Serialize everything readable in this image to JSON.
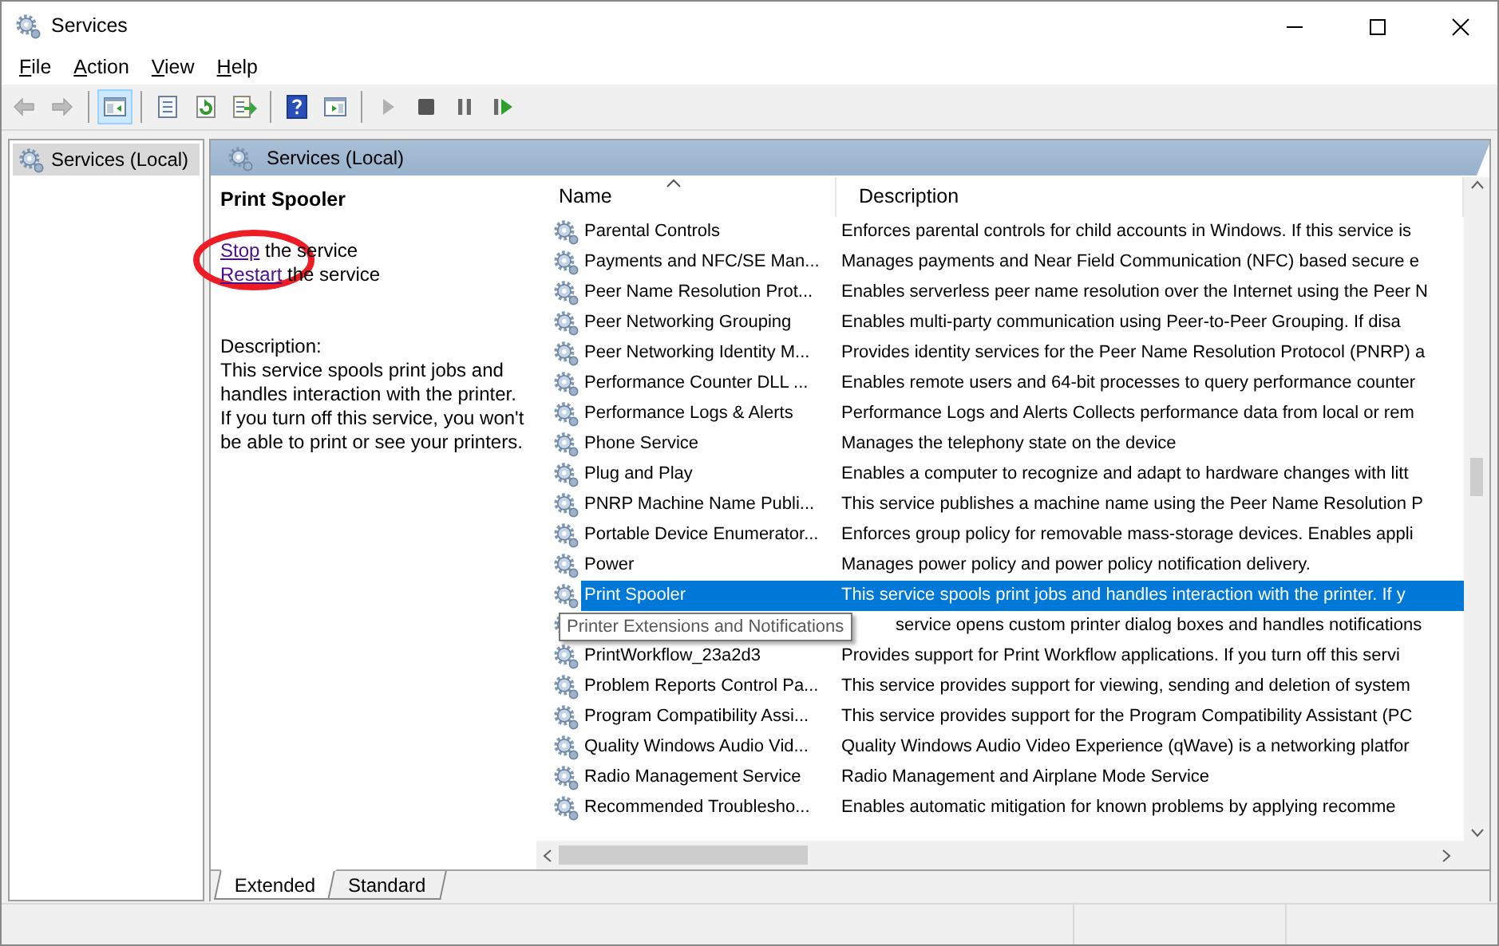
{
  "window": {
    "title": "Services"
  },
  "menu": [
    {
      "label": "File"
    },
    {
      "label": "Action"
    },
    {
      "label": "View"
    },
    {
      "label": "Help"
    }
  ],
  "toolbar": [
    {
      "kind": "back",
      "disabled": true,
      "selected": false
    },
    {
      "kind": "forward",
      "disabled": true,
      "selected": false
    },
    {
      "kind": "separator"
    },
    {
      "kind": "tree",
      "disabled": false,
      "selected": true
    },
    {
      "kind": "separator"
    },
    {
      "kind": "properties",
      "disabled": false,
      "selected": false
    },
    {
      "kind": "refresh",
      "disabled": false,
      "selected": false
    },
    {
      "kind": "export",
      "disabled": false,
      "selected": false
    },
    {
      "kind": "separator"
    },
    {
      "kind": "help",
      "disabled": false,
      "selected": false
    },
    {
      "kind": "view",
      "disabled": false,
      "selected": false
    },
    {
      "kind": "separator"
    },
    {
      "kind": "play",
      "disabled": true,
      "selected": false
    },
    {
      "kind": "stop",
      "disabled": false,
      "selected": false
    },
    {
      "kind": "pause",
      "disabled": false,
      "selected": false
    },
    {
      "kind": "resume",
      "disabled": false,
      "selected": false
    }
  ],
  "tree": [
    {
      "label": "Services (Local)",
      "selected": true
    }
  ],
  "panel_title": "Services (Local)",
  "details": {
    "title": "Print Spooler",
    "actions": [
      {
        "link": "Stop",
        "rest": "the service"
      },
      {
        "link": "Restart",
        "rest": "the service"
      }
    ],
    "description_label": "Description:",
    "description": "This service spools print jobs and handles interaction with the printer. If you turn off this service, you won't be able to print or see your printers."
  },
  "highlight_mark": {
    "kind": "ellipse"
  },
  "table": {
    "columns": [
      {
        "label": "Name",
        "sorted": true
      },
      {
        "label": "Description",
        "sorted": false
      }
    ],
    "rows": [
      {
        "name": "Parental Controls",
        "description": "Enforces parental controls for child accounts in Windows. If this service is",
        "selected": false
      },
      {
        "name": "Payments and NFC/SE Man...",
        "description": "Manages payments and Near Field Communication (NFC) based secure e",
        "selected": false
      },
      {
        "name": "Peer Name Resolution Prot...",
        "description": "Enables serverless peer name resolution over the Internet using the Peer N",
        "selected": false
      },
      {
        "name": "Peer Networking Grouping",
        "description": "Enables multi-party communication using Peer-to-Peer Grouping.  If disa",
        "selected": false
      },
      {
        "name": "Peer Networking Identity M...",
        "description": "Provides identity services for the Peer Name Resolution Protocol (PNRP) a",
        "selected": false
      },
      {
        "name": "Performance Counter DLL ...",
        "description": "Enables remote users and 64-bit processes to query performance counter",
        "selected": false
      },
      {
        "name": "Performance Logs & Alerts",
        "description": "Performance Logs and Alerts Collects performance data from local or rem",
        "selected": false
      },
      {
        "name": "Phone Service",
        "description": "Manages the telephony state on the device",
        "selected": false
      },
      {
        "name": "Plug and Play",
        "description": "Enables a computer to recognize and adapt to hardware changes with litt",
        "selected": false
      },
      {
        "name": "PNRP Machine Name Publi...",
        "description": "This service publishes a machine name using the Peer Name Resolution P",
        "selected": false
      },
      {
        "name": "Portable Device Enumerator...",
        "description": "Enforces group policy for removable mass-storage devices. Enables appli",
        "selected": false
      },
      {
        "name": "Power",
        "description": "Manages power policy and power policy notification delivery.",
        "selected": false
      },
      {
        "name": "Print Spooler",
        "description": "This service spools print jobs and handles interaction with the printer.  If y",
        "selected": true
      },
      {
        "tooltip": "Printer Extensions and Notifications",
        "description": "service opens custom printer dialog boxes and handles notifications",
        "selected": false
      },
      {
        "name": "PrintWorkflow_23a2d3",
        "description": "Provides support for Print Workflow applications. If you turn off this servi",
        "selected": false
      },
      {
        "name": "Problem Reports Control Pa...",
        "description": "This service provides support for viewing, sending and deletion of system",
        "selected": false
      },
      {
        "name": "Program Compatibility Assi...",
        "description": "This service provides support for the Program Compatibility Assistant (PC",
        "selected": false
      },
      {
        "name": "Quality Windows Audio Vid...",
        "description": "Quality Windows Audio Video Experience (qWave) is a networking platfor",
        "selected": false
      },
      {
        "name": "Radio Management Service",
        "description": "Radio Management and Airplane Mode Service",
        "selected": false
      },
      {
        "name": "Recommended Troublesho...",
        "description": "Enables automatic mitigation for known problems by applying recomme",
        "selected": false
      }
    ]
  },
  "tabs": [
    {
      "label": "Extended",
      "selected": true
    },
    {
      "label": "Standard",
      "selected": false
    }
  ]
}
